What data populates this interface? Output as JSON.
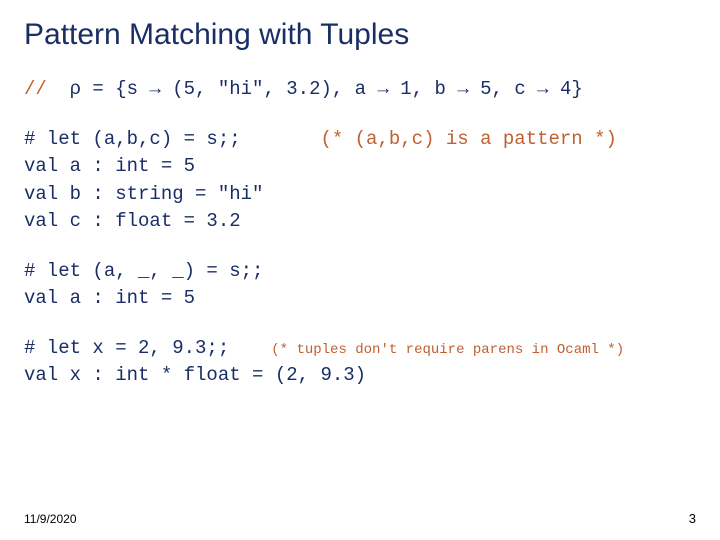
{
  "title": "Pattern Matching with Tuples",
  "env": {
    "dblslash": "//  ",
    "rho": "ρ",
    "eq": " = {s ",
    "arrow": "→",
    "tuple": " (5, \"hi\", 3.2), a ",
    "one": " 1, b ",
    "five": " 5, c ",
    "four": " 4}"
  },
  "blk1": {
    "l1a": "# let (a,b,c) = s;;",
    "l1b": "       (* (a,b,c) is a pattern *)",
    "l2": "val a : int = 5",
    "l3": "val b : string = \"hi\"",
    "l4": "val c : float = 3.2"
  },
  "blk2": {
    "l1": "# let (a, _, _) = s;;",
    "l2": "val a : int = 5"
  },
  "blk3": {
    "l1a": "# let x = 2, 9.3;;",
    "l1b": "     (* tuples don't require parens in Ocaml *)",
    "l2": "val x : int * float = (2, 9.3)"
  },
  "footer": {
    "date": "11/9/2020",
    "page": "3"
  }
}
